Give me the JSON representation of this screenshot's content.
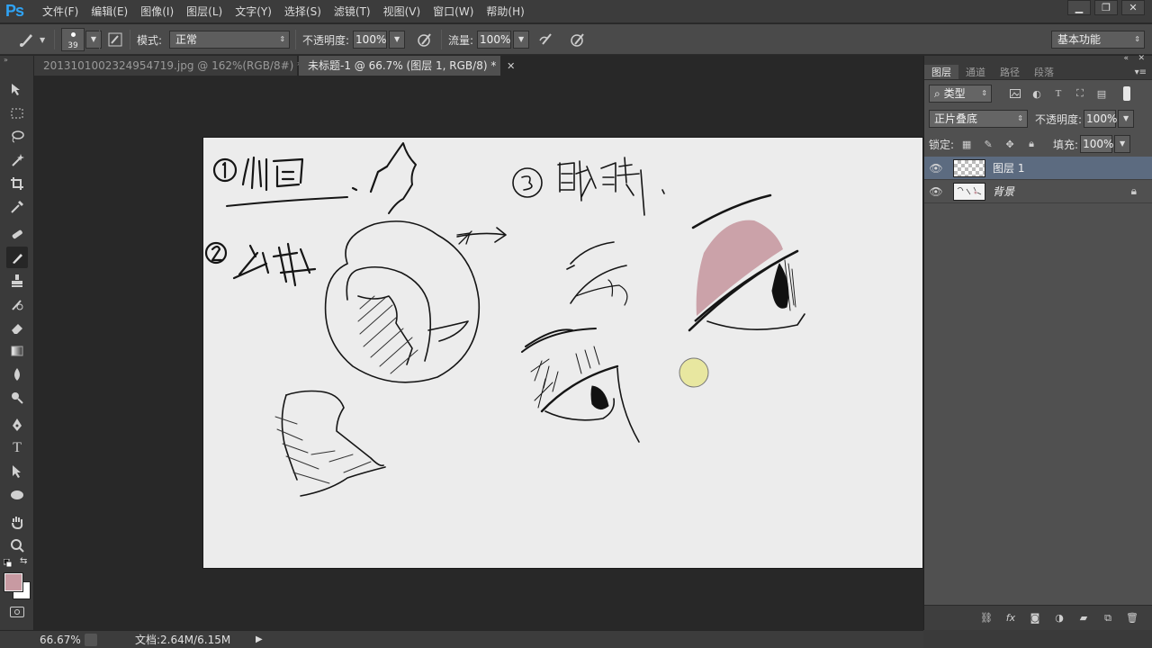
{
  "app": {
    "logo": "Ps"
  },
  "menu": [
    "文件(F)",
    "编辑(E)",
    "图像(I)",
    "图层(L)",
    "文字(Y)",
    "选择(S)",
    "滤镜(T)",
    "视图(V)",
    "窗口(W)",
    "帮助(H)"
  ],
  "window_controls": {
    "minimize": "▁",
    "restore": "❐",
    "close": "✕"
  },
  "options": {
    "brush_size": "39",
    "mode_label": "模式:",
    "mode_value": "正常",
    "opacity_label": "不透明度:",
    "opacity_value": "100%",
    "flow_label": "流量:",
    "flow_value": "100%",
    "workspace": "基本功能"
  },
  "tabs": [
    {
      "label": "2013101002324954719.jpg @ 162%(RGB/8#) *",
      "close": "✕"
    },
    {
      "label": "未标题-1 @ 66.7% (图层 1, RGB/8) *",
      "close": "✕"
    }
  ],
  "colors": {
    "foreground": "#c89aa2",
    "background": "#ffffff",
    "accent_ps": "#2fa3f5",
    "selected_layer": "#5c6b80",
    "canvas": "#ececec"
  },
  "panel": {
    "tabs": [
      "图层",
      "通道",
      "路径",
      "段落"
    ],
    "filter_kind": "类型",
    "blend_mode": "正片叠底",
    "opacity_label": "不透明度:",
    "opacity_value": "100%",
    "lock_label": "锁定:",
    "fill_label": "填充:",
    "fill_value": "100%",
    "layers": [
      {
        "name": "图层 1",
        "selected": true
      },
      {
        "name": "背景",
        "locked": true
      }
    ]
  },
  "status": {
    "zoom": "66.67%",
    "doc": "文档:2.64M/6.15M"
  }
}
